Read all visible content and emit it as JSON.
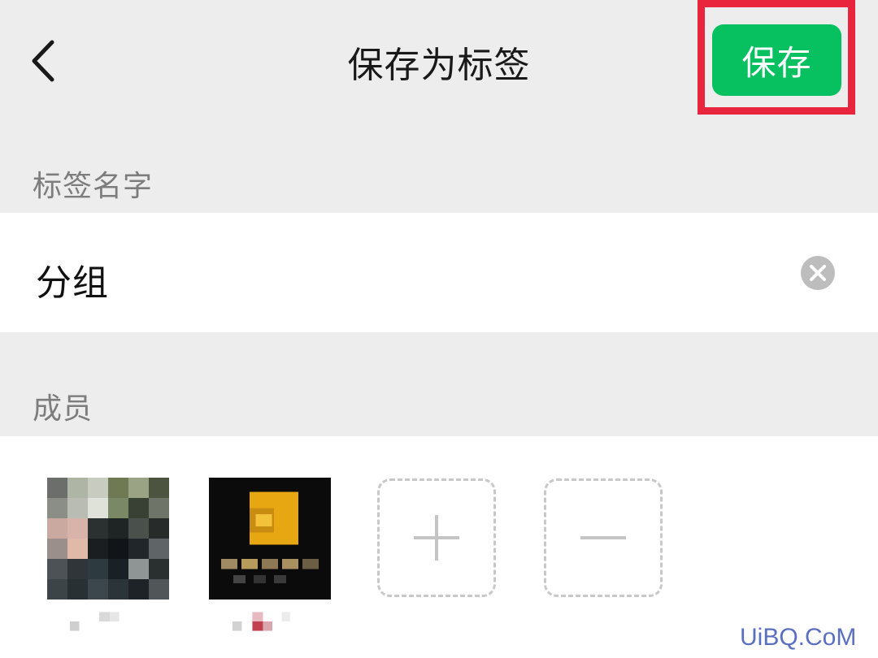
{
  "header": {
    "title": "保存为标签",
    "back_icon": "chevron-left-icon",
    "save_label": "保存"
  },
  "tag_name": {
    "label": "标签名字",
    "value": "分组",
    "clear_icon": "clear-circle-icon"
  },
  "members": {
    "label": "成员",
    "add_icon": "plus-icon",
    "remove_icon": "minus-icon"
  },
  "watermark": "UiBQ.CoM",
  "colors": {
    "accent_green": "#07c160",
    "highlight_red": "#e8253d",
    "background": "#ededed",
    "panel": "#ffffff"
  }
}
